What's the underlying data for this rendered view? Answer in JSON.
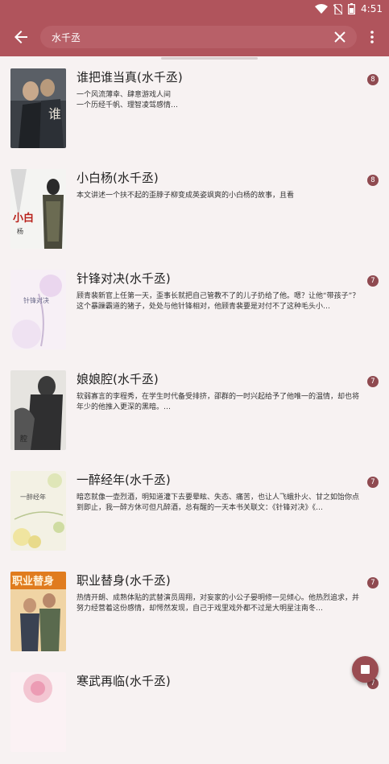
{
  "status_bar": {
    "time": "4:51"
  },
  "search": {
    "query": "水千丞",
    "placeholder": ""
  },
  "books": [
    {
      "title": "谁把谁当真(水千丞)",
      "description": "一个风流薄幸、肆意游戏人间\n        一个历经千帆、理智凌驾感情…",
      "count": "8",
      "cover_text": "谁把谁当真",
      "cover_theme": "dark"
    },
    {
      "title": "小白杨(水千丞)",
      "description": "本文讲述一个扶不起的歪脖子柳变成英姿飒爽的小白杨的故事，且看",
      "count": "8",
      "cover_text": "小白杨",
      "cover_theme": "white"
    },
    {
      "title": "针锋对决(水千丞)",
      "description": "顾青裴新官上任第一天，歪事长就把自己管教不了的儿子扔给了他。嗯？让他“带孩子”？这个暴躁霸道的猪子，处处与他针锋相对，他顾青裴要是对付不了这种毛头小…",
      "count": "7",
      "cover_text": "针锋对决",
      "cover_theme": "pastel"
    },
    {
      "title": "娘娘腔(水千丞)",
      "description": "软弱寡言的李程秀，在学生时代备受排挤，邵群的一时兴起给予了他唯一的温情，却也将年少的他推入更深的黑暗。…",
      "count": "7",
      "cover_text": "娘娘腔",
      "cover_theme": "grey"
    },
    {
      "title": "一醉经年(水千丞)",
      "description": "暗恋就像一壶烈酒，明知道灌下去要晕眩、失态、痛苦，也让人飞蛾扑火、甘之如饴你点到即止，我一醉方休可但凡醉酒，总有醒的一天本书关联文：《针锋对决》《…",
      "count": "7",
      "cover_text": "一醉经年",
      "cover_theme": "floral"
    },
    {
      "title": "职业替身(水千丞)",
      "description": "热情开朗、成熟体贴的武替演员周翔，对妄家的小公子晏明修一见倾心。他热烈追求，并努力经营着这份感情，却愕然发现，自己于戏里戏外都不过是大明星注南冬…",
      "count": "7",
      "cover_text": "职业替身",
      "cover_theme": "orange"
    },
    {
      "title": "寒武再临(水千丞)",
      "description": "",
      "count": "7",
      "cover_text": "",
      "cover_theme": "pink"
    }
  ]
}
